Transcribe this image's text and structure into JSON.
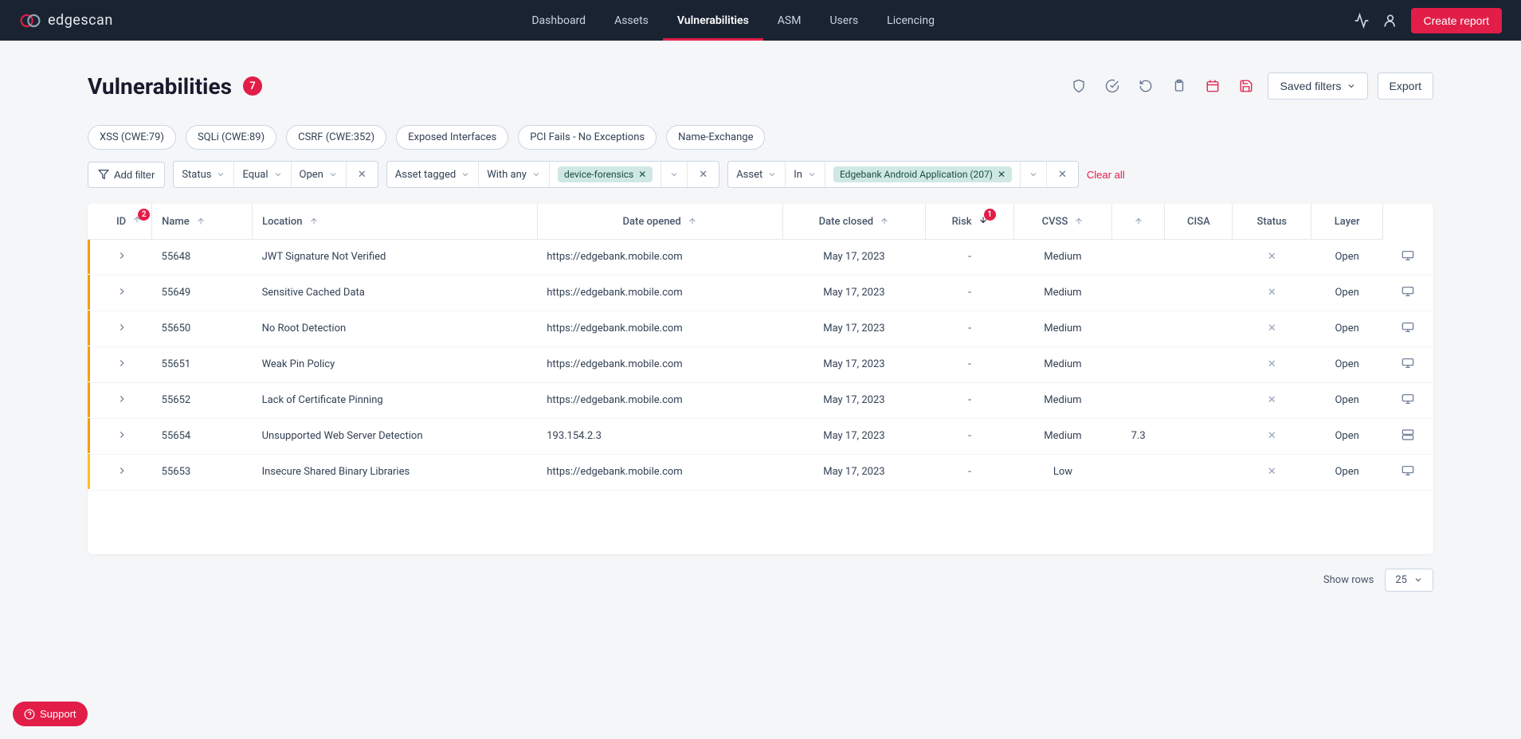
{
  "header": {
    "logo_text": "edgescan",
    "nav": [
      {
        "label": "Dashboard",
        "active": false
      },
      {
        "label": "Assets",
        "active": false
      },
      {
        "label": "Vulnerabilities",
        "active": true
      },
      {
        "label": "ASM",
        "active": false
      },
      {
        "label": "Users",
        "active": false
      },
      {
        "label": "Licencing",
        "active": false
      }
    ],
    "create_report": "Create report"
  },
  "page": {
    "title": "Vulnerabilities",
    "count": "7",
    "saved_filters": "Saved filters",
    "export": "Export"
  },
  "chips": [
    "XSS (CWE:79)",
    "SQLi (CWE:89)",
    "CSRF (CWE:352)",
    "Exposed Interfaces",
    "PCI Fails - No Exceptions",
    "Name-Exchange"
  ],
  "filters": {
    "add_filter": "Add filter",
    "status_group": {
      "field": "Status",
      "op": "Equal",
      "value": "Open"
    },
    "tag_group": {
      "field": "Asset tagged",
      "op": "With any",
      "value": "device-forensics"
    },
    "asset_group": {
      "field": "Asset",
      "op": "In",
      "value": "Edgebank Android Application (207)"
    },
    "clear_all": "Clear all"
  },
  "table": {
    "columns": {
      "id": "ID",
      "id_badge": "2",
      "name": "Name",
      "location": "Location",
      "date_opened": "Date opened",
      "date_closed": "Date closed",
      "risk": "Risk",
      "risk_badge": "1",
      "cvss": "CVSS",
      "cisa": "CISA",
      "status": "Status",
      "layer": "Layer"
    },
    "rows": [
      {
        "id": "55648",
        "name": "JWT Signature Not Verified",
        "location": "https://edgebank.mobile.com",
        "date_opened": "May 17, 2023",
        "date_closed": "-",
        "risk": "Medium",
        "cvss": "",
        "status": "Open",
        "layer": "monitor"
      },
      {
        "id": "55649",
        "name": "Sensitive Cached Data",
        "location": "https://edgebank.mobile.com",
        "date_opened": "May 17, 2023",
        "date_closed": "-",
        "risk": "Medium",
        "cvss": "",
        "status": "Open",
        "layer": "monitor"
      },
      {
        "id": "55650",
        "name": "No Root Detection",
        "location": "https://edgebank.mobile.com",
        "date_opened": "May 17, 2023",
        "date_closed": "-",
        "risk": "Medium",
        "cvss": "",
        "status": "Open",
        "layer": "monitor"
      },
      {
        "id": "55651",
        "name": "Weak Pin Policy",
        "location": "https://edgebank.mobile.com",
        "date_opened": "May 17, 2023",
        "date_closed": "-",
        "risk": "Medium",
        "cvss": "",
        "status": "Open",
        "layer": "monitor"
      },
      {
        "id": "55652",
        "name": "Lack of Certificate Pinning",
        "location": "https://edgebank.mobile.com",
        "date_opened": "May 17, 2023",
        "date_closed": "-",
        "risk": "Medium",
        "cvss": "",
        "status": "Open",
        "layer": "monitor"
      },
      {
        "id": "55654",
        "name": "Unsupported Web Server Detection",
        "location": "193.154.2.3",
        "date_opened": "May 17, 2023",
        "date_closed": "-",
        "risk": "Medium",
        "cvss": "7.3",
        "status": "Open",
        "layer": "server"
      },
      {
        "id": "55653",
        "name": "Insecure Shared Binary Libraries",
        "location": "https://edgebank.mobile.com",
        "date_opened": "May 17, 2023",
        "date_closed": "-",
        "risk": "Low",
        "cvss": "",
        "status": "Open",
        "layer": "monitor"
      }
    ]
  },
  "footer": {
    "show_rows": "Show rows",
    "rows_value": "25"
  },
  "support": "Support"
}
